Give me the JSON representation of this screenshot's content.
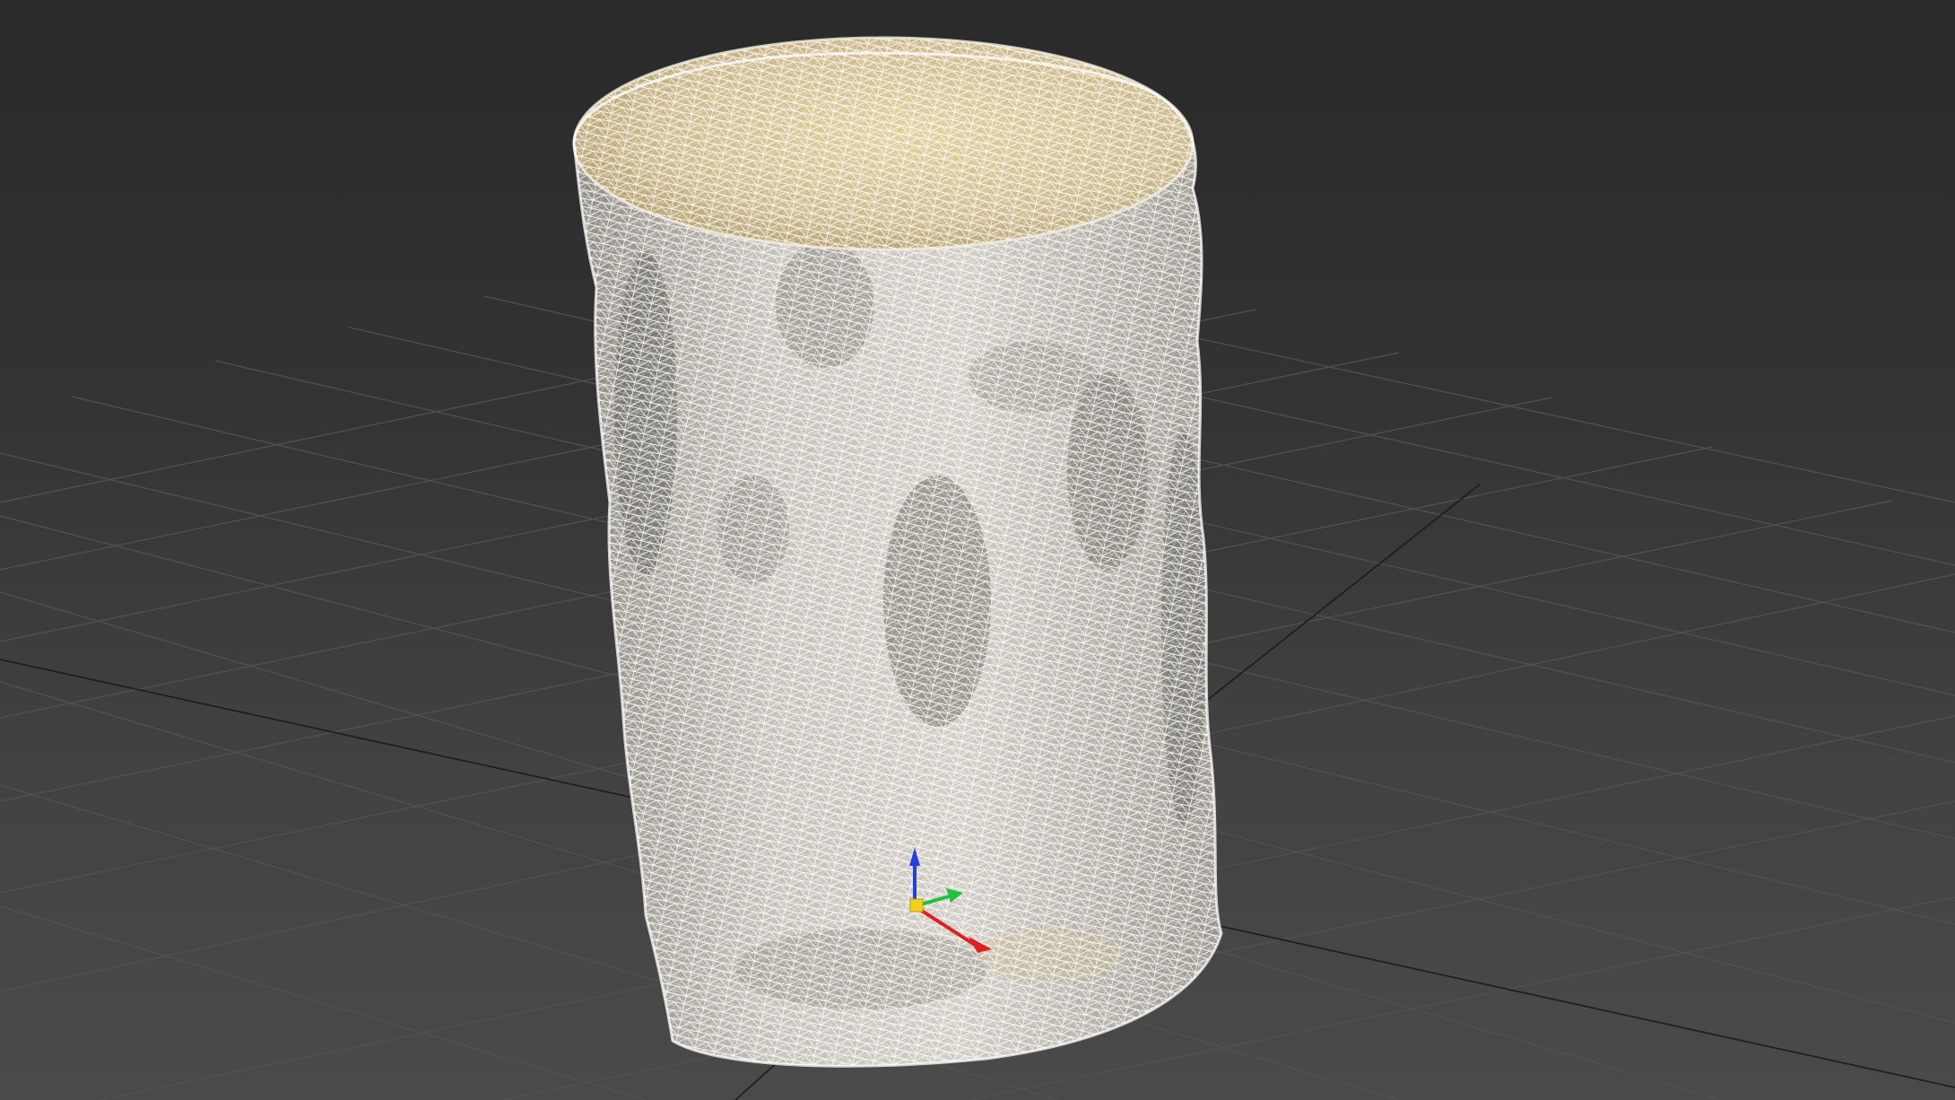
{
  "viewport": {
    "view": "perspective",
    "shading": "wireframe-over-shaded"
  },
  "scene": {
    "object": "tree-stump-scan",
    "background_top": "#2a2a2a",
    "background_bottom": "#4a4a4a",
    "grid_color": "#505050",
    "grid_axis_color": "#1a1a1a"
  },
  "colors": {
    "bark": "#b8b4ac",
    "bark_shadow": "#7d7a72",
    "top_face": "#cdb98a",
    "wireframe": "#ffffff",
    "gizmo_x": "#e02020",
    "gizmo_y": "#20c040",
    "gizmo_z": "#2040e0"
  },
  "gizmo": {
    "axes": [
      "x-axis",
      "y-axis",
      "z-axis"
    ]
  }
}
